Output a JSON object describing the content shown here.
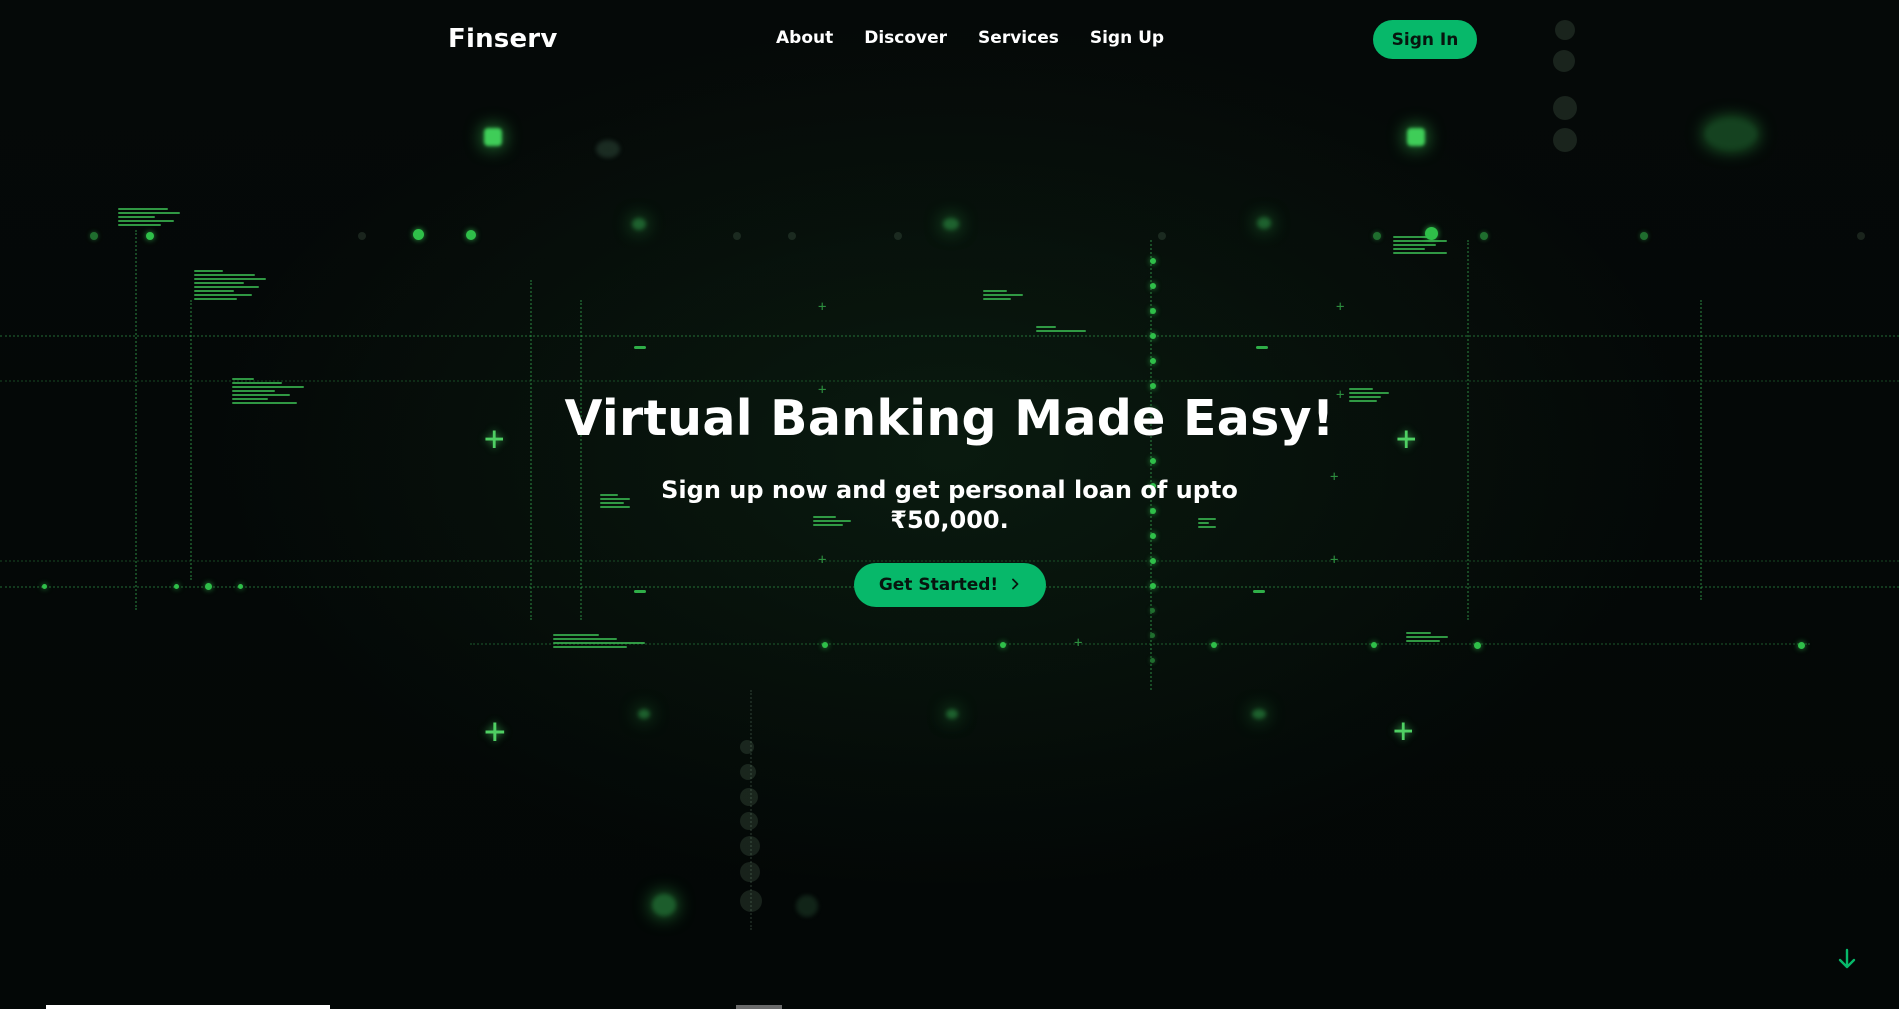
{
  "header": {
    "brand": "Finserv",
    "nav": [
      {
        "label": "About"
      },
      {
        "label": "Discover"
      },
      {
        "label": "Services"
      },
      {
        "label": "Sign Up"
      }
    ],
    "signin_label": "Sign In"
  },
  "hero": {
    "title": "Virtual Banking Made Easy!",
    "subtitle_line1": "Sign up now and get personal loan of upto",
    "subtitle_line2": "₹50,000.",
    "cta_label": "Get Started!",
    "cta_icon": "chevron-right-icon"
  },
  "scroll_icon": "arrow-down-icon",
  "progress": {
    "fraction": 0.157
  },
  "colors": {
    "accent": "#07b86a",
    "background": "#040807",
    "glow_green": "#3fcd58"
  }
}
